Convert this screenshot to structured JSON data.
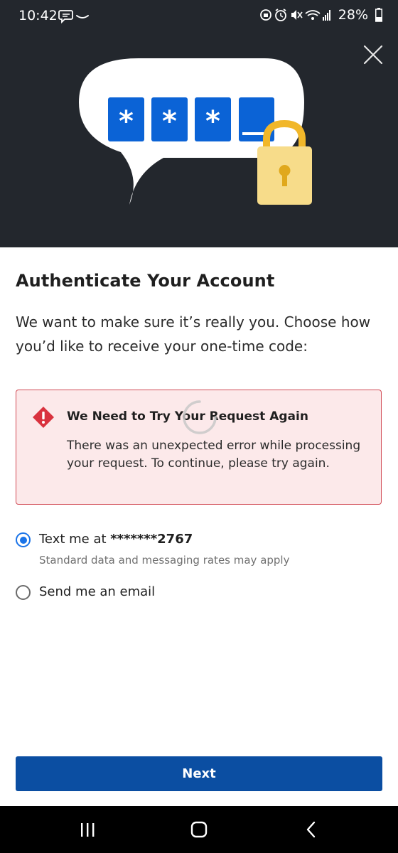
{
  "status_bar": {
    "time": "10:42",
    "battery": "28%",
    "icons": [
      "message-icon",
      "amazon-smile-icon",
      "alarm-lock-icon",
      "alarm-clock-icon",
      "mute-icon",
      "wifi-icon",
      "signal-icon",
      "battery-icon"
    ]
  },
  "hero": {
    "close_icon": "close-icon",
    "code_chars": [
      "*",
      "*",
      "*"
    ],
    "colors": {
      "background": "#23272d",
      "code_box": "#0b63d6",
      "lock_body": "#f7dc8a",
      "lock_shackle": "#f1b72a"
    }
  },
  "page": {
    "title": "Authenticate Your Account",
    "subtitle": "We want to make sure it’s really you. Choose how you’d like to receive your one-time code:"
  },
  "error": {
    "title": "We Need to Try Your Request Again",
    "body": "There was an unexpected error while processing your request. To continue, please try again.",
    "icon": "warning-diamond-icon",
    "colors": {
      "background": "#fce9ea",
      "border": "#d14b55",
      "icon": "#d9323e"
    }
  },
  "options": [
    {
      "label_prefix": "Text me at ",
      "label_value": "*******2767",
      "note": "Standard data and messaging rates may apply",
      "selected": true
    },
    {
      "label": "Send me an email",
      "selected": false
    }
  ],
  "actions": {
    "next_label": "Next",
    "accent": "#0b4ea2"
  },
  "nav_bar": {
    "icons": [
      "recent-apps-icon",
      "home-icon",
      "back-icon"
    ]
  }
}
